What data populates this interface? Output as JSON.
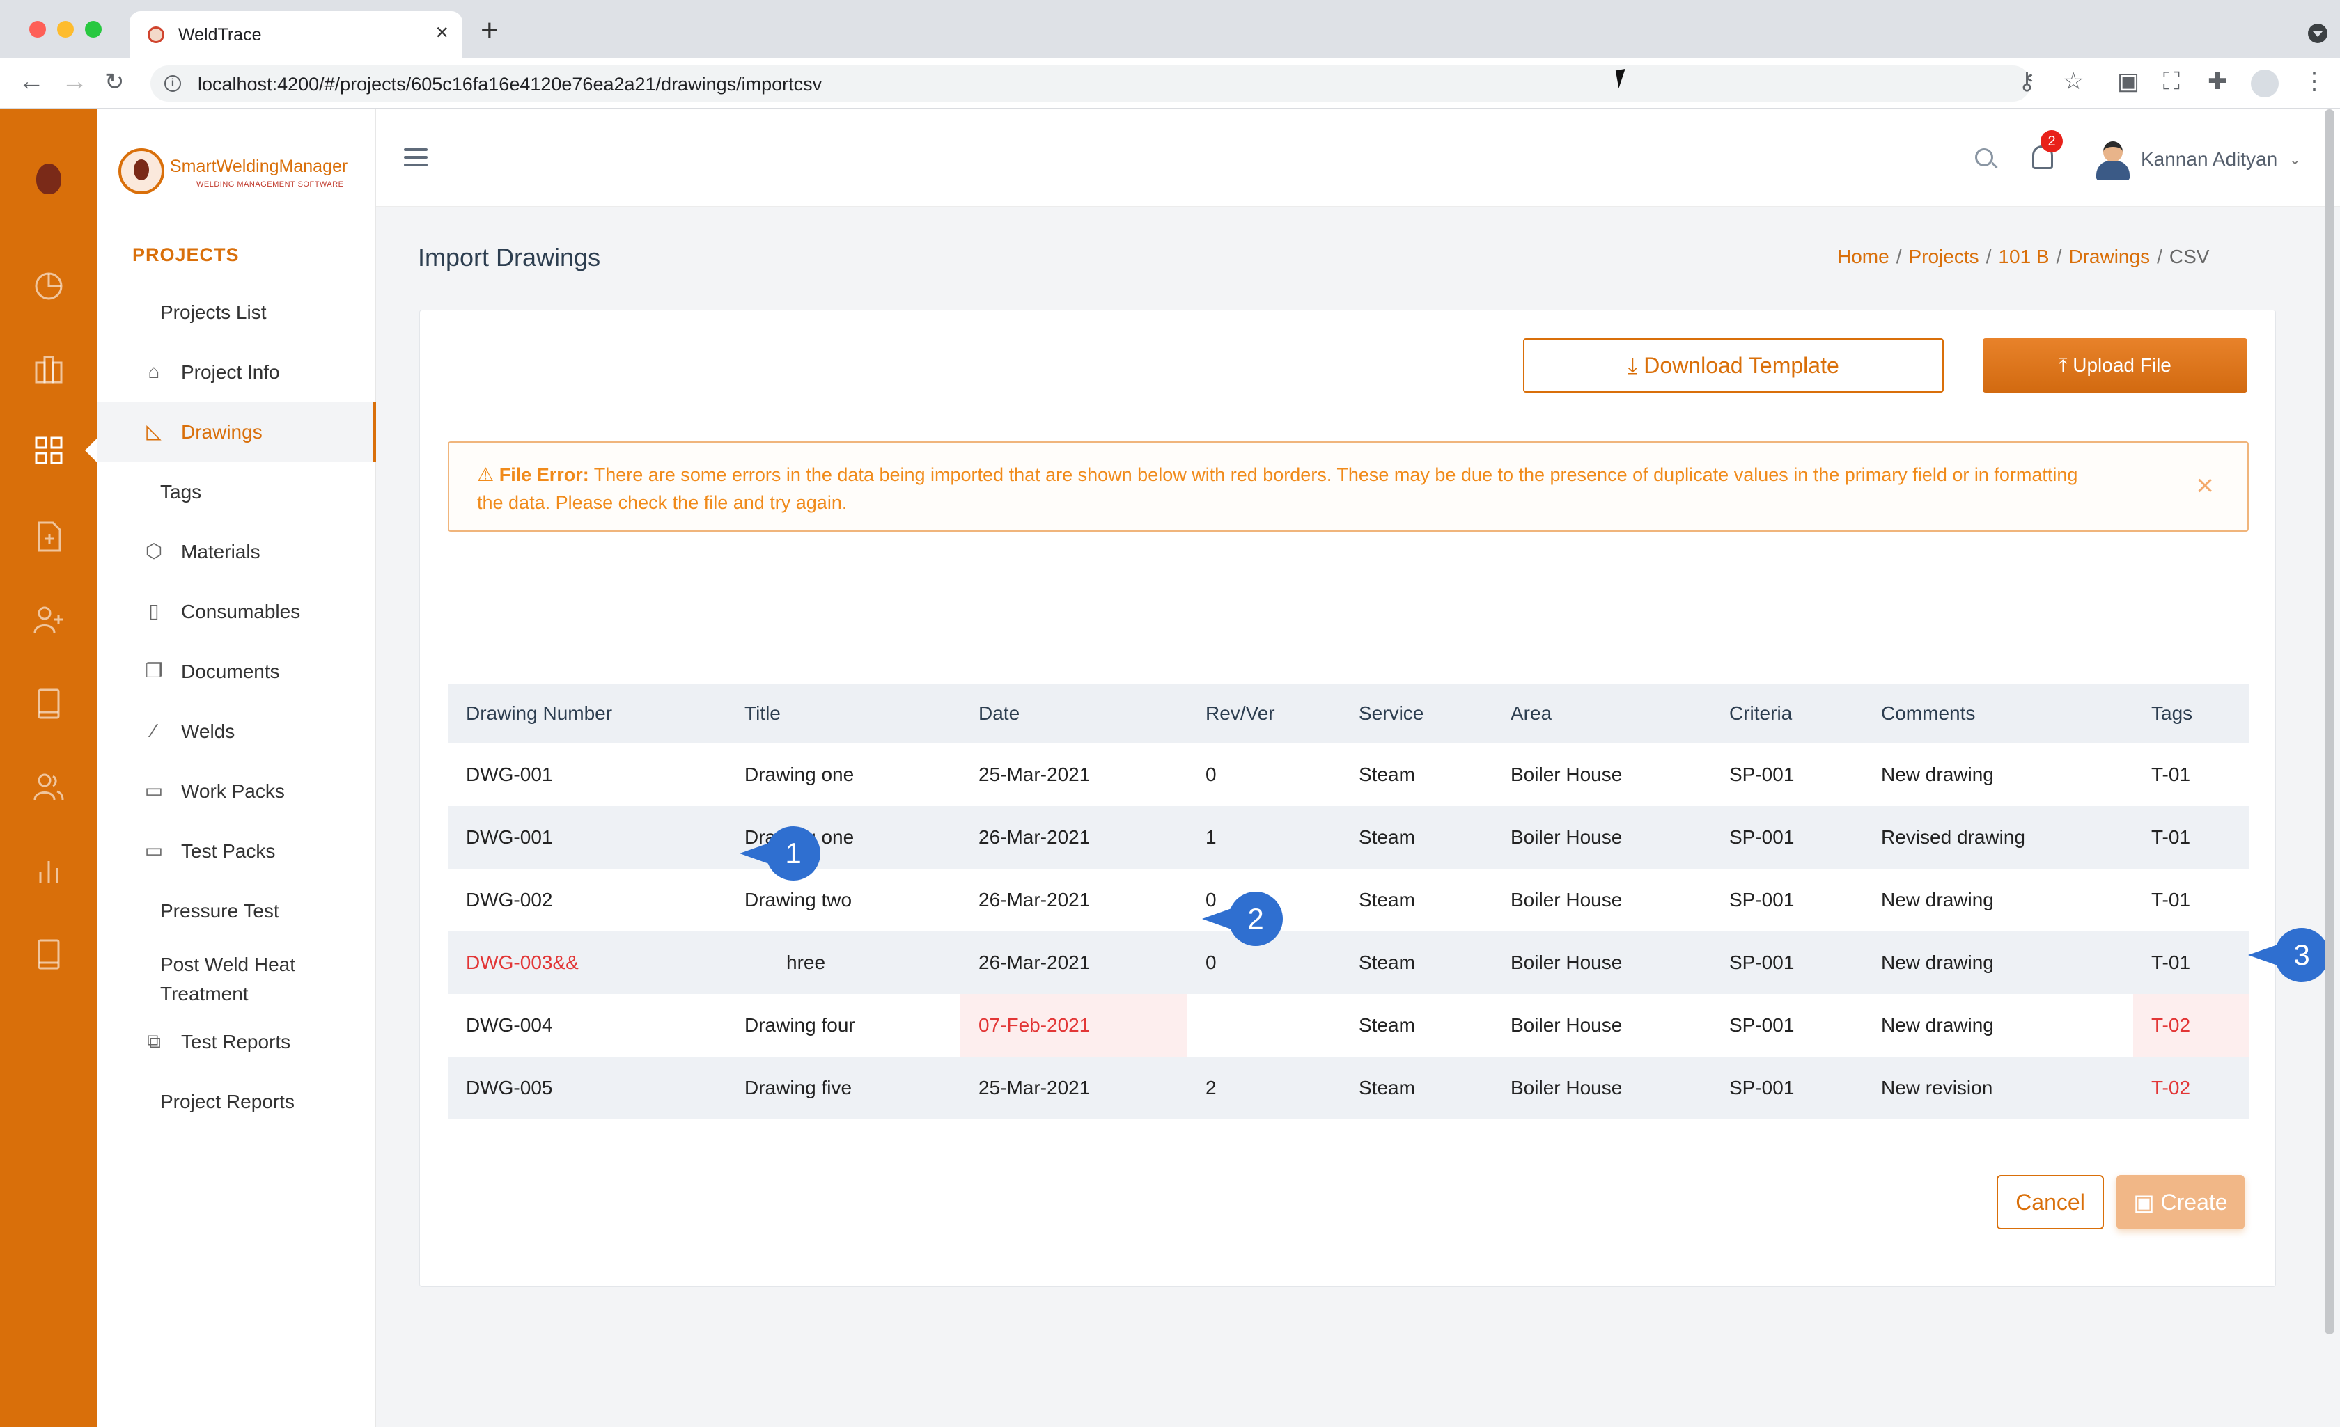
{
  "browser": {
    "tab_title": "WeldTrace",
    "url": "localhost:4200/#/projects/605c16fa16e4120e76ea2a21/drawings/importcsv"
  },
  "brand": {
    "name": "SmartWeldingManager",
    "subtitle": "WELDING MANAGEMENT SOFTWARE",
    "accent_color": "#d96f0a"
  },
  "sidebar": {
    "section": "PROJECTS",
    "items": [
      {
        "label": "Projects List",
        "icon": ""
      },
      {
        "label": "Project Info",
        "icon": "briefcase-icon"
      },
      {
        "label": "Drawings",
        "icon": "drafting-icon",
        "active": true
      },
      {
        "label": "Tags",
        "icon": ""
      },
      {
        "label": "Materials",
        "icon": "box-icon"
      },
      {
        "label": "Consumables",
        "icon": "consumables-icon"
      },
      {
        "label": "Documents",
        "icon": "documents-icon"
      },
      {
        "label": "Welds",
        "icon": "wand-icon"
      },
      {
        "label": "Work Packs",
        "icon": "clipboard-icon"
      },
      {
        "label": "Test Packs",
        "icon": "clipboard-icon"
      },
      {
        "label": "Pressure Test",
        "icon": ""
      },
      {
        "label": "Post Weld Heat Treatment",
        "icon": ""
      },
      {
        "label": "Test Reports",
        "icon": "copy-icon"
      },
      {
        "label": "Project Reports",
        "icon": ""
      }
    ]
  },
  "header": {
    "notification_count": "2",
    "user_name": "Kannan Adityan"
  },
  "page": {
    "title": "Import Drawings",
    "breadcrumb": {
      "home": "Home",
      "projects": "Projects",
      "project": "101 B",
      "drawings": "Drawings",
      "current": "CSV"
    }
  },
  "actions": {
    "download_template": "Download Template",
    "upload_file": "Upload File",
    "cancel": "Cancel",
    "create": "Create"
  },
  "alert": {
    "title": "File Error:",
    "message": "There are some errors in the data being imported that are shown below with red borders. These may be due to the presence of duplicate values in the primary field or in formatting the data. Please check the file and try again."
  },
  "table": {
    "headers": [
      "Drawing Number",
      "Title",
      "Date",
      "Rev/Ver",
      "Service",
      "Area",
      "Criteria",
      "Comments",
      "Tags"
    ],
    "rows": [
      [
        "DWG-001",
        "Drawing one",
        "25-Mar-2021",
        "0",
        "Steam",
        "Boiler House",
        "SP-001",
        "New drawing",
        "T-01"
      ],
      [
        "DWG-001",
        "Drawing one",
        "26-Mar-2021",
        "1",
        "Steam",
        "Boiler House",
        "SP-001",
        "Revised drawing",
        "T-01"
      ],
      [
        "DWG-002",
        "Drawing two",
        "26-Mar-2021",
        "0",
        "Steam",
        "Boiler House",
        "SP-001",
        "New drawing",
        "T-01"
      ],
      [
        "DWG-003&&",
        "hree",
        "26-Mar-2021",
        "0",
        "Steam",
        "Boiler House",
        "SP-001",
        "New drawing",
        "T-01"
      ],
      [
        "DWG-004",
        "Drawing four",
        "07-Feb-2021",
        "",
        "Steam",
        "Boiler House",
        "SP-001",
        "New drawing",
        "T-02"
      ],
      [
        "DWG-005",
        "Drawing five",
        "25-Mar-2021",
        "2",
        "Steam",
        "Boiler House",
        "SP-001",
        "New revision",
        "T-02"
      ]
    ]
  },
  "callouts": [
    "1",
    "2",
    "3"
  ]
}
